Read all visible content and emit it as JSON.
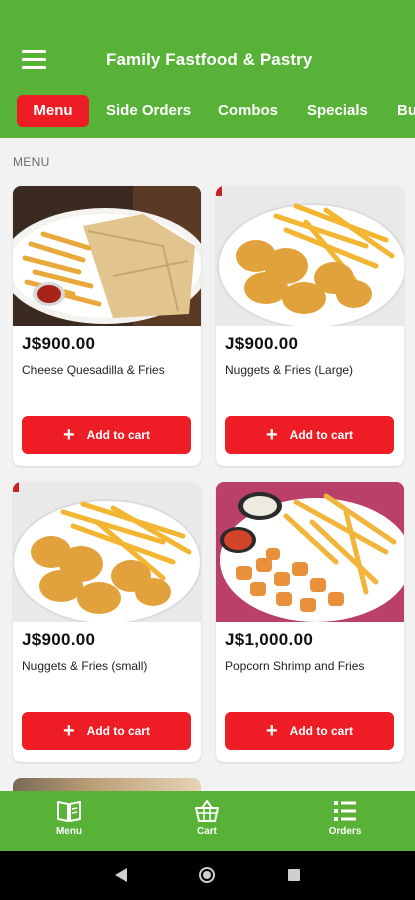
{
  "app": {
    "title": "Family Fastfood & Pastry"
  },
  "tabs": [
    {
      "label": "Menu",
      "active": true
    },
    {
      "label": "Side Orders"
    },
    {
      "label": "Combos"
    },
    {
      "label": "Specials"
    },
    {
      "label": "Bu"
    }
  ],
  "section": {
    "label": "MENU"
  },
  "products": [
    {
      "price": "J$900.00",
      "name": "Cheese Quesadilla & Fries",
      "button": "Add to cart"
    },
    {
      "price": "J$900.00",
      "name": "Nuggets & Fries (Large)",
      "button": "Add to cart"
    },
    {
      "price": "J$900.00",
      "name": "Nuggets & Fries (small)",
      "button": "Add to cart"
    },
    {
      "price": "J$1,000.00",
      "name": "Popcorn Shrimp and Fries",
      "button": "Add to cart"
    }
  ],
  "bottom_nav": [
    {
      "label": "Menu",
      "icon": "book-icon"
    },
    {
      "label": "Cart",
      "icon": "basket-icon"
    },
    {
      "label": "Orders",
      "icon": "list-icon"
    }
  ],
  "colors": {
    "header": "#57b237",
    "accent": "#ee1c24",
    "background": "#f2f2f2"
  }
}
